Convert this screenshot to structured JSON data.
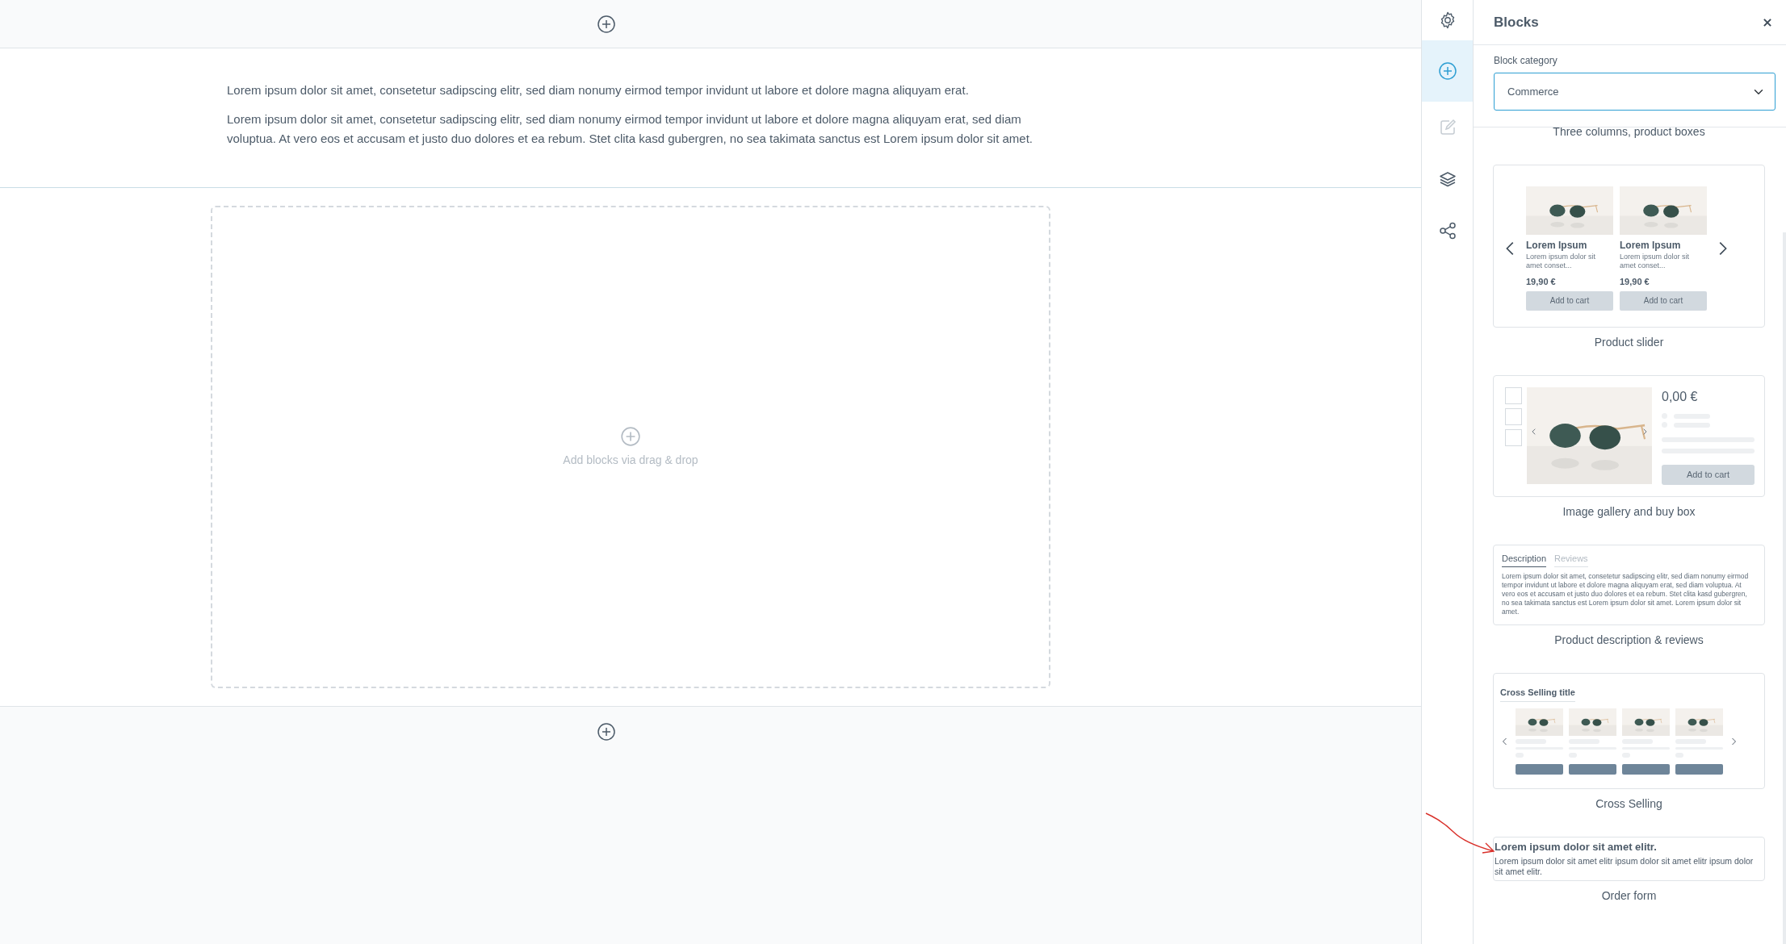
{
  "canvas": {
    "sections": [
      {
        "kind": "add"
      },
      {
        "kind": "text",
        "paragraphs": [
          "Lorem ipsum dolor sit amet, consetetur sadipscing elitr, sed diam nonumy eirmod tempor invidunt ut labore et dolore magna aliquyam erat.",
          "Lorem ipsum dolor sit amet, consetetur sadipscing elitr, sed diam nonumy eirmod tempor invidunt ut labore et dolore magna aliquyam erat, sed diam voluptua. At vero eos et accusam et justo duo dolores et ea rebum. Stet clita kasd gubergren, no sea takimata sanctus est Lorem ipsum dolor sit amet."
        ]
      },
      {
        "kind": "dropzone",
        "hint": "Add blocks via drag & drop"
      },
      {
        "kind": "add"
      }
    ]
  },
  "toolbar": {
    "items": [
      {
        "kind": "settings",
        "selected": false,
        "disabled": false
      },
      {
        "kind": "add",
        "selected": true,
        "disabled": false
      },
      {
        "kind": "edit",
        "selected": false,
        "disabled": true
      },
      {
        "kind": "layers",
        "selected": false,
        "disabled": false
      },
      {
        "kind": "share",
        "selected": false,
        "disabled": false
      }
    ]
  },
  "panel": {
    "title": "Blocks",
    "category_label": "Block category",
    "category_value": "Commerce",
    "blocks": [
      {
        "kind": "cut",
        "label": "Three columns, product boxes"
      },
      {
        "kind": "product_slider",
        "label": "Product slider",
        "products": [
          {
            "name": "Lorem Ipsum",
            "text": "Lorem ipsum dolor sit amet conset...",
            "price": "19,90 €",
            "button": "Add to cart"
          },
          {
            "name": "Lorem Ipsum",
            "text": "Lorem ipsum dolor sit amet conset...",
            "price": "19,90 €",
            "button": "Add to cart"
          }
        ]
      },
      {
        "kind": "gallery",
        "label": "Image gallery and buy box",
        "price": "0,00 €",
        "button": "Add to cart"
      },
      {
        "kind": "description",
        "label": "Product description & reviews",
        "tabs": [
          {
            "label": "Description",
            "selected": true
          },
          {
            "label": "Reviews",
            "selected": false
          }
        ],
        "text": "Lorem ipsum dolor sit amet, consetetur sadipscing elitr, sed diam nonumy eirmod tempor invidunt ut labore et dolore magna aliquyam erat, sed diam voluptua. At vero eos et accusam et justo duo dolores et ea rebum. Stet clita kasd gubergren, no sea takimata sanctus est Lorem ipsum dolor sit amet. Lorem ipsum dolor sit amet."
      },
      {
        "kind": "cross_selling",
        "label": "Cross Selling",
        "title": "Cross Selling title"
      },
      {
        "kind": "order_form",
        "label": "Order form",
        "heading": "Lorem ipsum dolor sit amet elitr.",
        "text": "Lorem ipsum dolor sit amet elitr ipsum dolor sit amet elitr ipsum dolor sit amet elitr."
      }
    ]
  }
}
